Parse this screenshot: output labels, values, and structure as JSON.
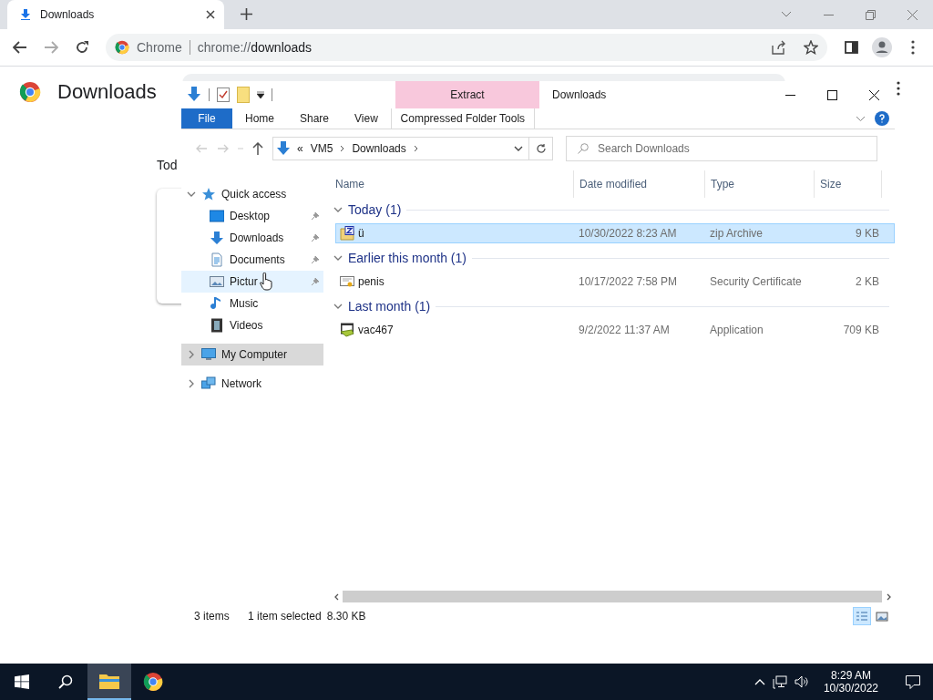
{
  "browser": {
    "tab": {
      "title": "Downloads",
      "selected": true
    },
    "omnibox": {
      "site_label": "Chrome",
      "url_scheme": "chrome://",
      "url_host": "downloads"
    }
  },
  "downloads_page": {
    "title": "Downloads",
    "section_partial": "Tod"
  },
  "explorer": {
    "title": "Downloads",
    "context_tab": "Extract",
    "ribbon_tabs": [
      {
        "label": "File",
        "kind": "file",
        "selected": false
      },
      {
        "label": "Home",
        "kind": "tab",
        "selected": false
      },
      {
        "label": "Share",
        "kind": "tab",
        "selected": false
      },
      {
        "label": "View",
        "kind": "tab",
        "selected": false
      },
      {
        "label": "Compressed Folder Tools",
        "kind": "context",
        "selected": false
      }
    ],
    "address": {
      "overflow": "«",
      "segments": [
        "VM5",
        "Downloads"
      ]
    },
    "search": {
      "placeholder": "Search Downloads"
    },
    "nav": [
      {
        "label": "Quick access",
        "kind": "star",
        "expanded": true,
        "selected": false,
        "hovered": false,
        "children": [
          {
            "label": "Desktop",
            "kind": "desktop",
            "pinned": true,
            "selected": false,
            "hovered": false
          },
          {
            "label": "Downloads",
            "kind": "downloads",
            "pinned": true,
            "selected": false,
            "hovered": false
          },
          {
            "label": "Documents",
            "kind": "documents",
            "pinned": true,
            "selected": false,
            "hovered": false
          },
          {
            "label": "Pictur",
            "kind": "pictures",
            "pinned": true,
            "selected": false,
            "hovered": true
          },
          {
            "label": "Music",
            "kind": "music",
            "pinned": false,
            "selected": false,
            "hovered": false
          },
          {
            "label": "Videos",
            "kind": "videos",
            "pinned": false,
            "selected": false,
            "hovered": false
          }
        ]
      },
      {
        "label": "My Computer",
        "kind": "computer",
        "expanded": false,
        "selected": true,
        "hovered": false
      },
      {
        "label": "Network",
        "kind": "network",
        "expanded": false,
        "selected": false,
        "hovered": false
      }
    ],
    "columns": [
      "Name",
      "Date modified",
      "Type",
      "Size"
    ],
    "groups": [
      {
        "title": "Today (1)",
        "expanded": true,
        "files": [
          {
            "name": "ü",
            "kind": "zip",
            "date": "10/30/2022 8:23 AM",
            "type": "zip Archive",
            "size": "9 KB",
            "selected": true
          }
        ]
      },
      {
        "title": "Earlier this month (1)",
        "expanded": true,
        "files": [
          {
            "name": "penis",
            "kind": "certificate",
            "date": "10/17/2022 7:58 PM",
            "type": "Security Certificate",
            "size": "2 KB",
            "selected": false
          }
        ]
      },
      {
        "title": "Last month (1)",
        "expanded": true,
        "files": [
          {
            "name": "vac467",
            "kind": "application",
            "date": "9/2/2022 11:37 AM",
            "type": "Application",
            "size": "709 KB",
            "selected": false
          }
        ]
      }
    ],
    "status": {
      "count": "3 items",
      "selection": "1 item selected",
      "selection_size": "8.30 KB"
    },
    "view_modes": [
      {
        "kind": "details",
        "selected": true
      },
      {
        "kind": "tiles",
        "selected": false
      }
    ]
  },
  "taskbar": {
    "apps": [
      {
        "kind": "explorer",
        "active": true
      },
      {
        "kind": "chrome",
        "active": false
      }
    ],
    "time": "8:29 AM",
    "date": "10/30/2022"
  }
}
